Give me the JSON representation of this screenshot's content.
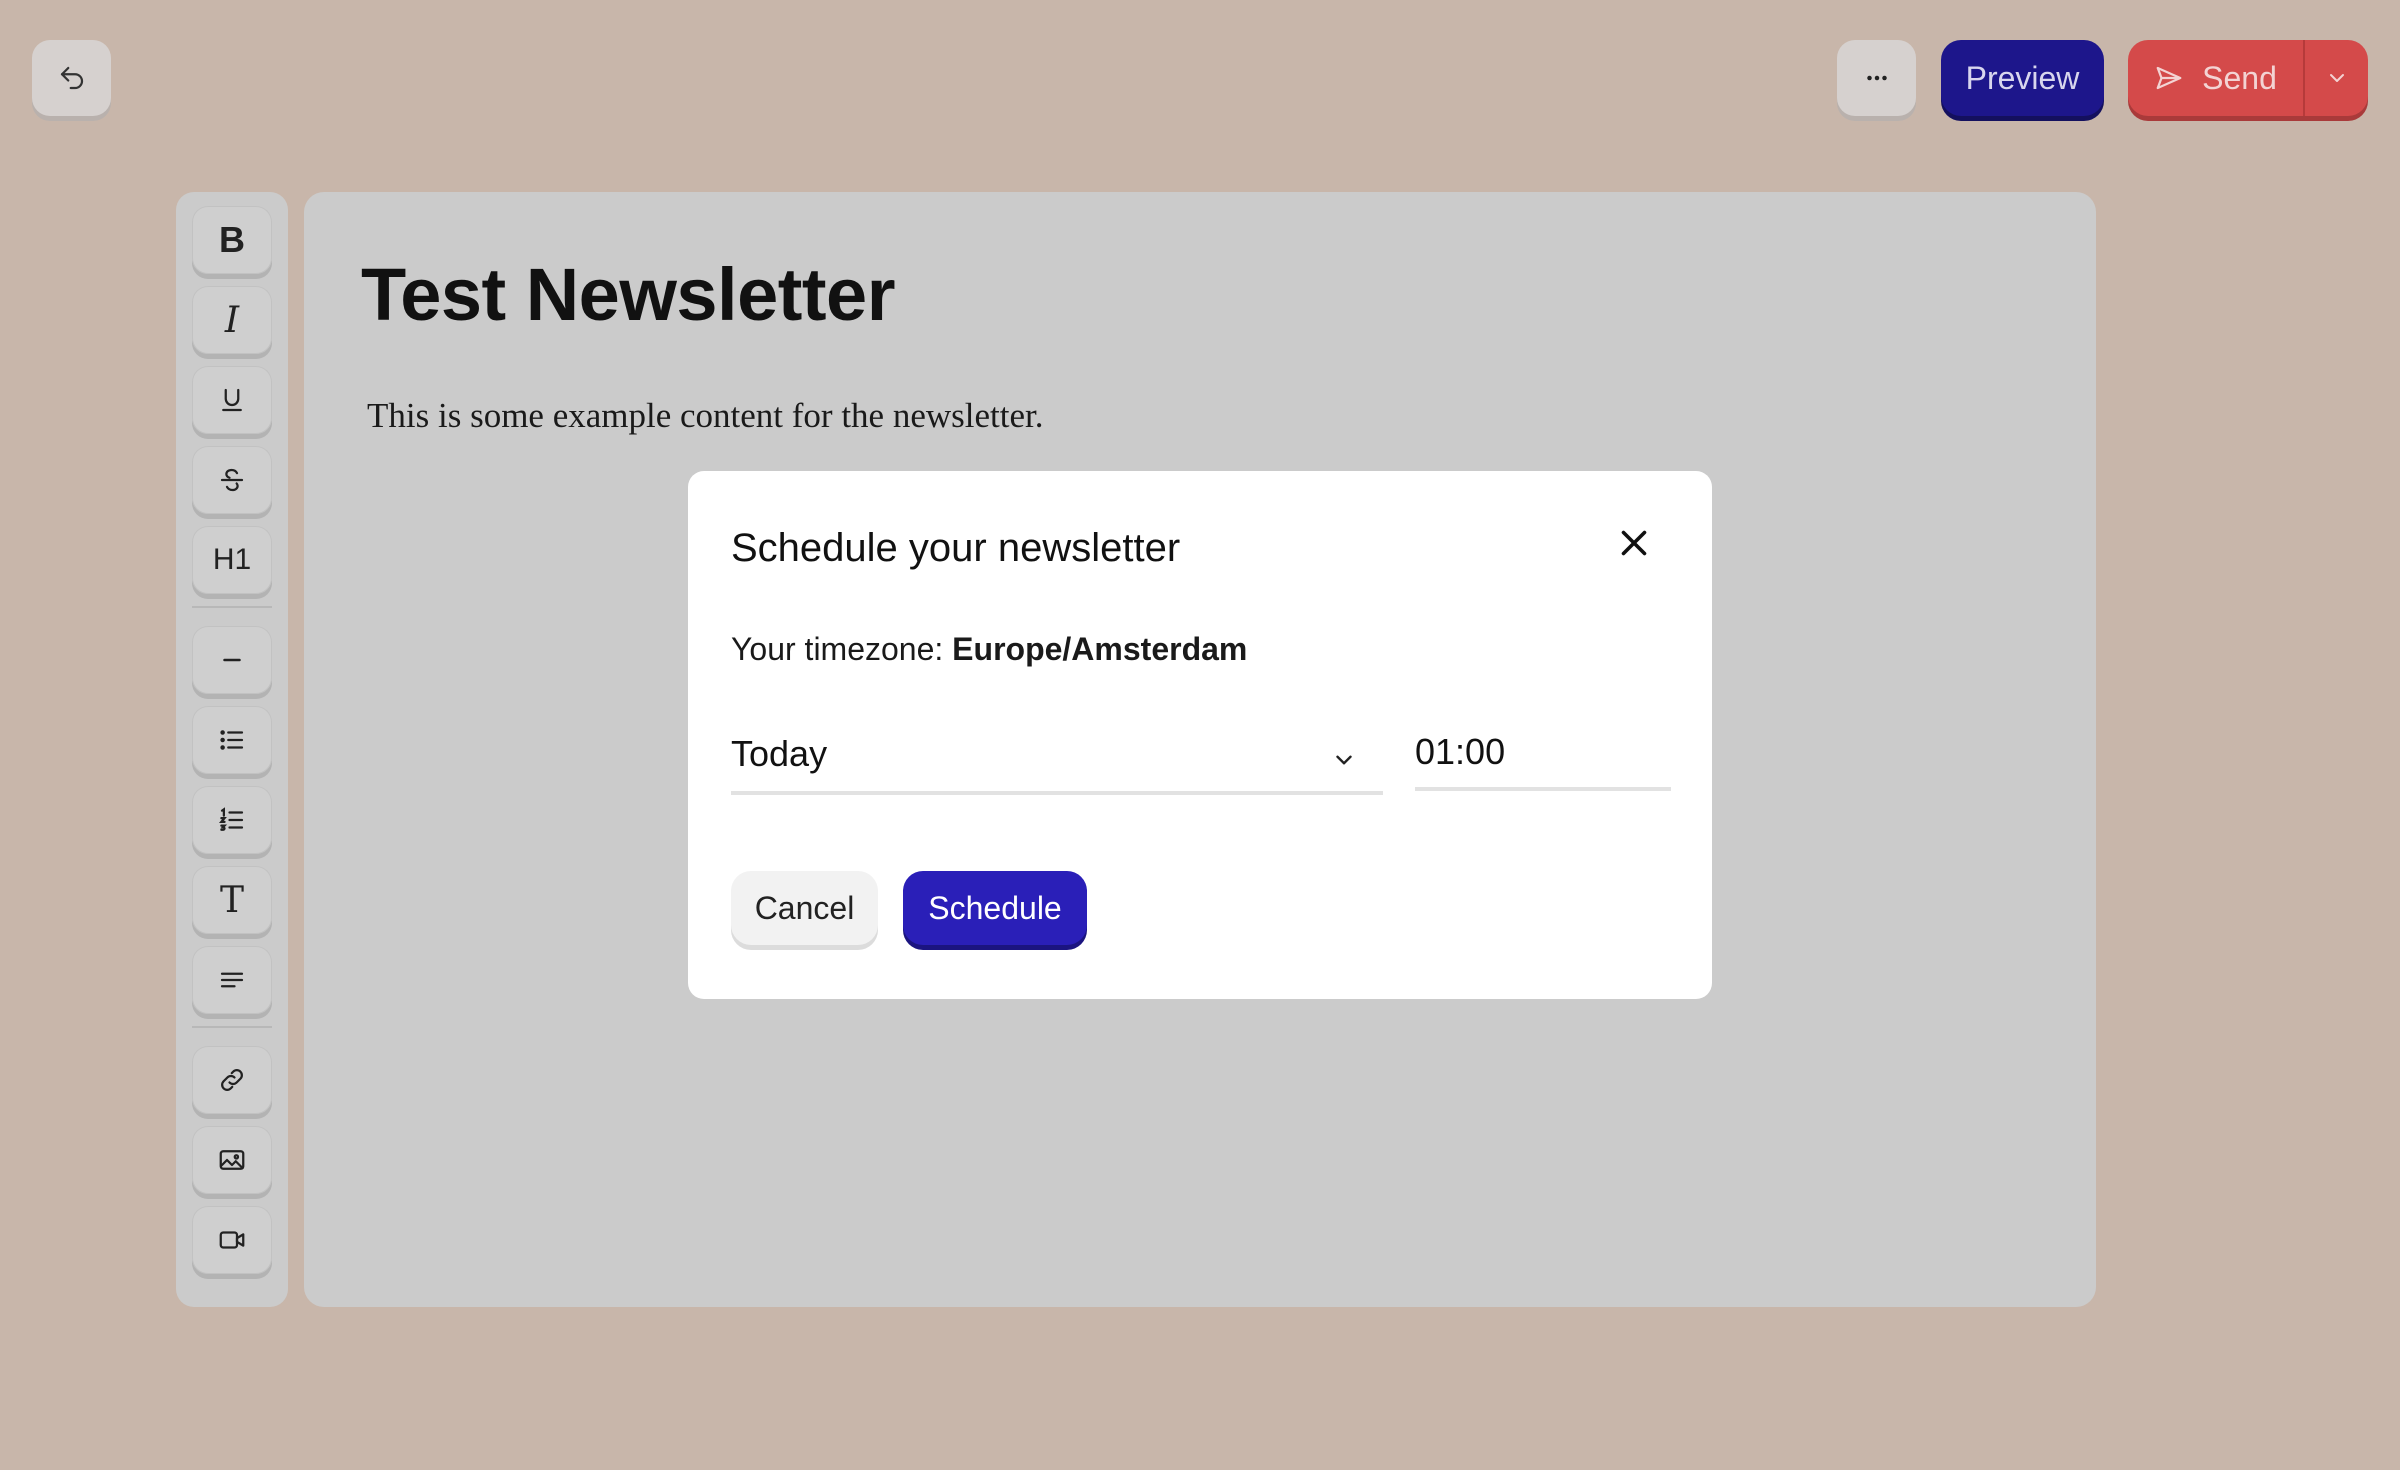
{
  "header": {
    "back_icon": "undo-arrow-icon",
    "more_icon": "more-horizontal-icon",
    "preview_label": "Preview",
    "send_label": "Send",
    "send_icon": "paper-plane-icon",
    "send_caret_icon": "chevron-down-icon"
  },
  "toolbar": {
    "items": [
      {
        "name": "bold",
        "glyph": "B"
      },
      {
        "name": "italic",
        "glyph": "I"
      },
      {
        "name": "underline",
        "glyph": "U"
      },
      {
        "name": "strikethrough",
        "glyph": "S"
      },
      {
        "name": "heading-1",
        "glyph": "H1"
      },
      {
        "name": "horizontal-rule",
        "glyph": "—"
      },
      {
        "name": "bullet-list",
        "glyph": ""
      },
      {
        "name": "numbered-list",
        "glyph": ""
      },
      {
        "name": "text",
        "glyph": "T"
      },
      {
        "name": "paragraph",
        "glyph": ""
      },
      {
        "name": "link",
        "glyph": ""
      },
      {
        "name": "image",
        "glyph": ""
      },
      {
        "name": "video",
        "glyph": ""
      }
    ]
  },
  "editor": {
    "title": "Test Newsletter",
    "body": "This is some example content for the newsletter."
  },
  "modal": {
    "title": "Schedule your newsletter",
    "timezone_label": "Your timezone: ",
    "timezone_value": "Europe/Amsterdam",
    "date_value": "Today",
    "time_value": "01:00",
    "cancel_label": "Cancel",
    "schedule_label": "Schedule"
  },
  "colors": {
    "background": "#c8b6aa",
    "preview": "#1d168b",
    "send": "#d44a4a",
    "schedule": "#2a1fb8"
  }
}
